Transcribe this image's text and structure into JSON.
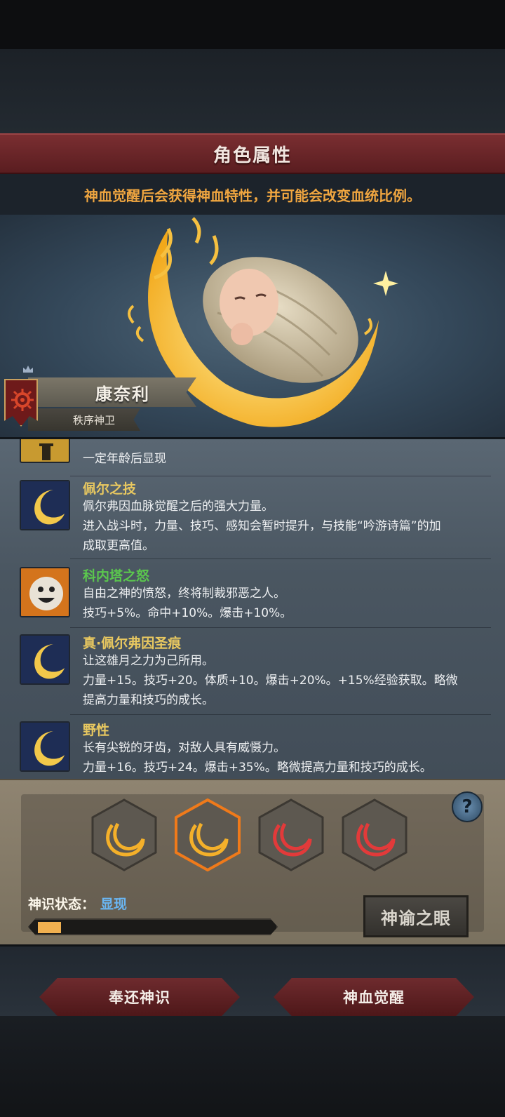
{
  "header": {
    "title": "角色属性"
  },
  "notice": {
    "text": "神血觉醒后会获得神血特性，并可能会改变血统比例。"
  },
  "character": {
    "name": "康奈利",
    "title": "秩序神卫"
  },
  "traits": [
    {
      "name": "",
      "lines": [
        "一定年龄后显现"
      ],
      "icon": "tower-icon"
    },
    {
      "name": "佩尔之技",
      "lines": [
        "佩尔弗因血脉觉醒之后的强大力量。",
        "进入战斗时，力量、技巧、感知会暂时提升，与技能“吟游诗篇”的加",
        "成取更高值。"
      ],
      "icon": "moon-icon"
    },
    {
      "name": "科内塔之怒",
      "lines": [
        "自由之神的愤怒，终将制裁邪恶之人。",
        "技巧+5%。命中+10%。爆击+10%。"
      ],
      "icon": "face-icon"
    },
    {
      "name": "真·佩尔弗因圣痕",
      "lines": [
        "让这雄月之力为己所用。",
        "力量+15。技巧+20。体质+10。爆击+20%。+15%经验获取。略微",
        "提高力量和技巧的成长。"
      ],
      "icon": "moon-icon"
    },
    {
      "name": "野性",
      "lines": [
        "长有尖锐的牙齿，对敌人具有威慑力。",
        "力量+16。技巧+24。爆击+35%。略微提高力量和技巧的成长。"
      ],
      "icon": "moon-icon"
    }
  ],
  "awakening": {
    "slots": [
      "gold",
      "gold-selected",
      "red",
      "red"
    ],
    "status_label": "神识状态：",
    "status_value": "显现",
    "progress": 0.1,
    "help_label": "?",
    "eye_button": "神谕之眼"
  },
  "actions": {
    "return_label": "奉还神识",
    "awaken_label": "神血觉醒"
  },
  "colors": {
    "accent_gold": "#f0a640",
    "banner_red": "#6e2b2e",
    "status_blue": "#6ab6f2"
  }
}
